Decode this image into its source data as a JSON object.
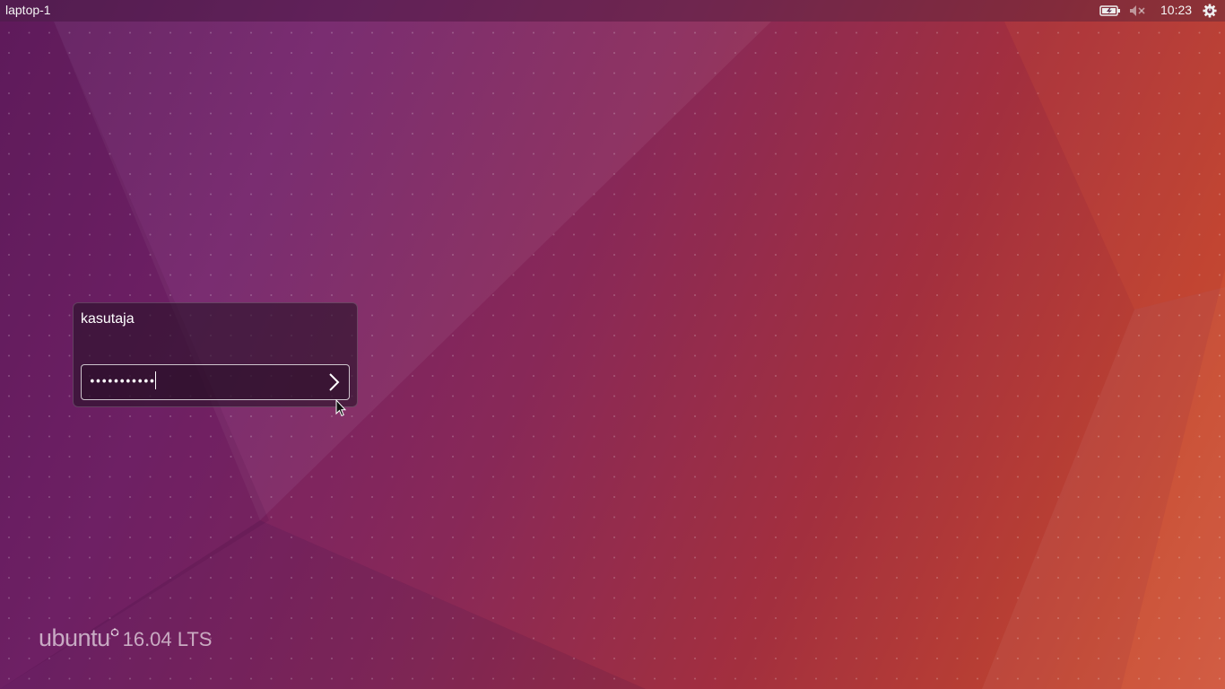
{
  "panel": {
    "hostname": "laptop-1",
    "clock": "10:23",
    "icons": [
      "battery-charging-icon",
      "sound-muted-icon",
      "session-gear-icon"
    ]
  },
  "login": {
    "username": "kasutaja",
    "password_mask": "•••••••••••",
    "submit_icon": "chevron-right-icon"
  },
  "branding": {
    "logo_text": "ubuntu",
    "version": "16.04 LTS"
  },
  "colors": {
    "wallpaper_start": "#5f1d5e",
    "wallpaper_mid": "#8a2b5c",
    "wallpaper_end": "#d0553a",
    "text": "#ffffff"
  }
}
